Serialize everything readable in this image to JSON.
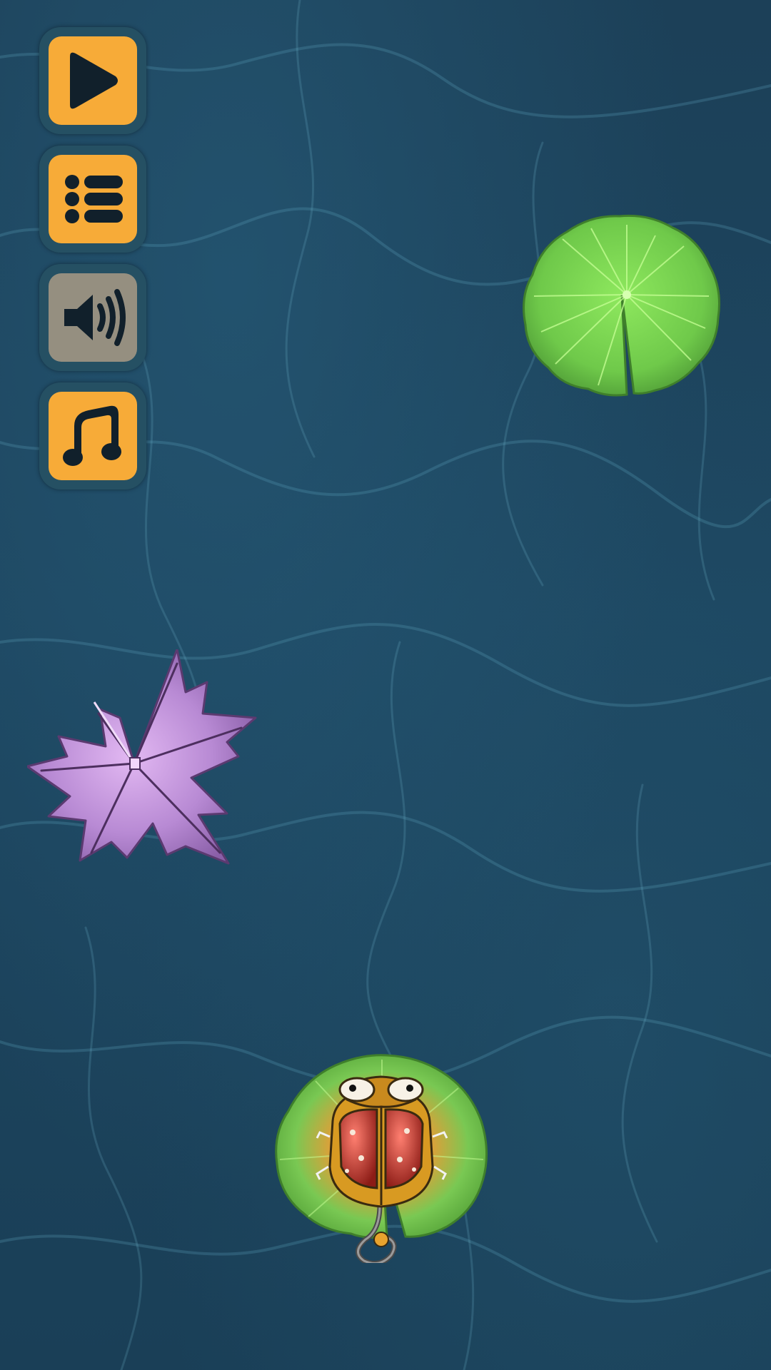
{
  "scene": {
    "water_color": "#1d4660",
    "caustic_color": "#5b9fb8"
  },
  "menu": {
    "accent_color": "#f7ab38",
    "disabled_color": "#958f80",
    "buttons": [
      {
        "icon": "play-icon",
        "state": "enabled"
      },
      {
        "icon": "list-icon",
        "state": "enabled"
      },
      {
        "icon": "sound-icon",
        "state": "muted"
      },
      {
        "icon": "music-icon",
        "state": "enabled"
      }
    ]
  },
  "objects": [
    {
      "type": "lily-pad",
      "color": "#6fc94a"
    },
    {
      "type": "maple-leaf",
      "color": "#b88ad4"
    },
    {
      "type": "ladybug-on-lily-pad",
      "color": "#b8322a"
    }
  ]
}
